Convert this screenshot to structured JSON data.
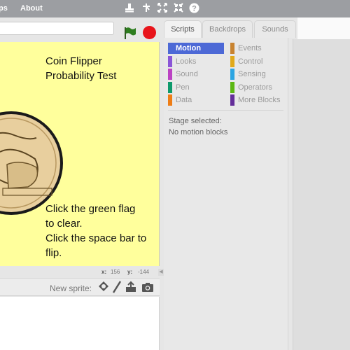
{
  "menubar": {
    "items": [
      "ps",
      "About"
    ],
    "tools": [
      {
        "name": "duplicate-icon",
        "glyph": "⊥"
      },
      {
        "name": "cut-icon",
        "glyph": "✢"
      },
      {
        "name": "grow-icon",
        "glyph": "⤡"
      },
      {
        "name": "shrink-icon",
        "glyph": "⤢"
      },
      {
        "name": "help-icon",
        "glyph": "?"
      }
    ]
  },
  "project": {
    "title_value": ""
  },
  "controls": {
    "flag_color": "#2e7d1f",
    "stop_color": "#e8141a"
  },
  "stage": {
    "background_color": "#ffff9c",
    "title_lines": [
      "Coin Flipper",
      "Probability Test"
    ],
    "instructions": [
      "Click the green flag",
      "to clear.",
      "Click the space bar to",
      "flip."
    ],
    "sprite": "coin"
  },
  "coords": {
    "x_label": "x:",
    "x_value": "156",
    "y_label": "y:",
    "y_value": "-144"
  },
  "sprites_bar": {
    "label": "New sprite:",
    "buttons": [
      {
        "name": "choose-sprite-from-library-icon",
        "glyph": "♠"
      },
      {
        "name": "paint-new-sprite-icon",
        "glyph": "/"
      },
      {
        "name": "upload-sprite-icon",
        "glyph": "⇪"
      },
      {
        "name": "camera-icon",
        "glyph": "◙"
      }
    ]
  },
  "tabs": [
    {
      "label": "Scripts",
      "active": true
    },
    {
      "label": "Backdrops",
      "active": false
    },
    {
      "label": "Sounds",
      "active": false
    }
  ],
  "categories": [
    {
      "label": "Motion",
      "color": "#4a6cd4",
      "selected": true
    },
    {
      "label": "Looks",
      "color": "#8a55d7"
    },
    {
      "label": "Sound",
      "color": "#bb42c3"
    },
    {
      "label": "Pen",
      "color": "#0e9a6c"
    },
    {
      "label": "Data",
      "color": "#ee7d16"
    },
    {
      "label": "Events",
      "color": "#c88330"
    },
    {
      "label": "Control",
      "color": "#e1a91a"
    },
    {
      "label": "Sensing",
      "color": "#2ca5e2"
    },
    {
      "label": "Operators",
      "color": "#5cb712"
    },
    {
      "label": "More Blocks",
      "color": "#632d99"
    }
  ],
  "palette": {
    "line1": "Stage selected:",
    "line2": "No motion blocks"
  }
}
